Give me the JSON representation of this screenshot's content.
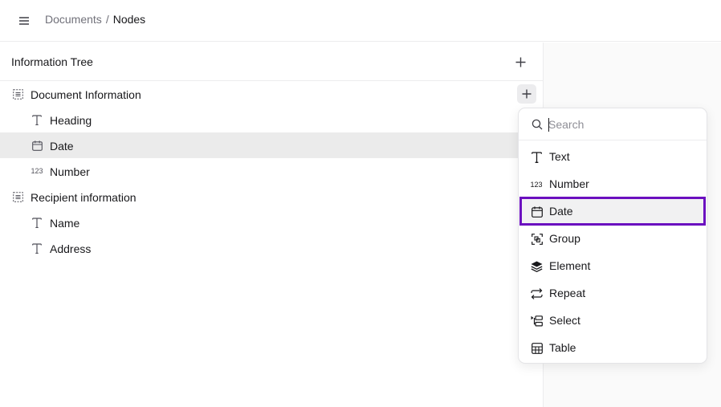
{
  "breadcrumb": {
    "parent": "Documents",
    "separator": "/",
    "current": "Nodes"
  },
  "tree": {
    "title": "Information Tree",
    "rows": [
      {
        "label": "Document Information",
        "icon": "group-icon",
        "level": 0
      },
      {
        "label": "Heading",
        "icon": "text-icon",
        "level": 1
      },
      {
        "label": "Date",
        "icon": "calendar-icon",
        "level": 1,
        "selected": true
      },
      {
        "label": "Number",
        "icon": "number-icon",
        "level": 1,
        "glyph": "123"
      },
      {
        "label": "Recipient information",
        "icon": "group-icon",
        "level": 0
      },
      {
        "label": "Name",
        "icon": "text-icon",
        "level": 1
      },
      {
        "label": "Address",
        "icon": "text-icon",
        "level": 1
      }
    ]
  },
  "popover": {
    "search_placeholder": "Search",
    "items": [
      {
        "label": "Text",
        "icon": "text-icon"
      },
      {
        "label": "Number",
        "icon": "number-icon",
        "glyph": "123"
      },
      {
        "label": "Date",
        "icon": "calendar-icon",
        "active": true
      },
      {
        "label": "Group",
        "icon": "group-scan-icon"
      },
      {
        "label": "Element",
        "icon": "layers-icon"
      },
      {
        "label": "Repeat",
        "icon": "repeat-icon"
      },
      {
        "label": "Select",
        "icon": "select-icon"
      },
      {
        "label": "Table",
        "icon": "table-icon"
      }
    ]
  },
  "colors": {
    "highlight_outline": "#6b0fbf",
    "selected_row": "#ebebeb",
    "muted_text": "#71717a"
  }
}
